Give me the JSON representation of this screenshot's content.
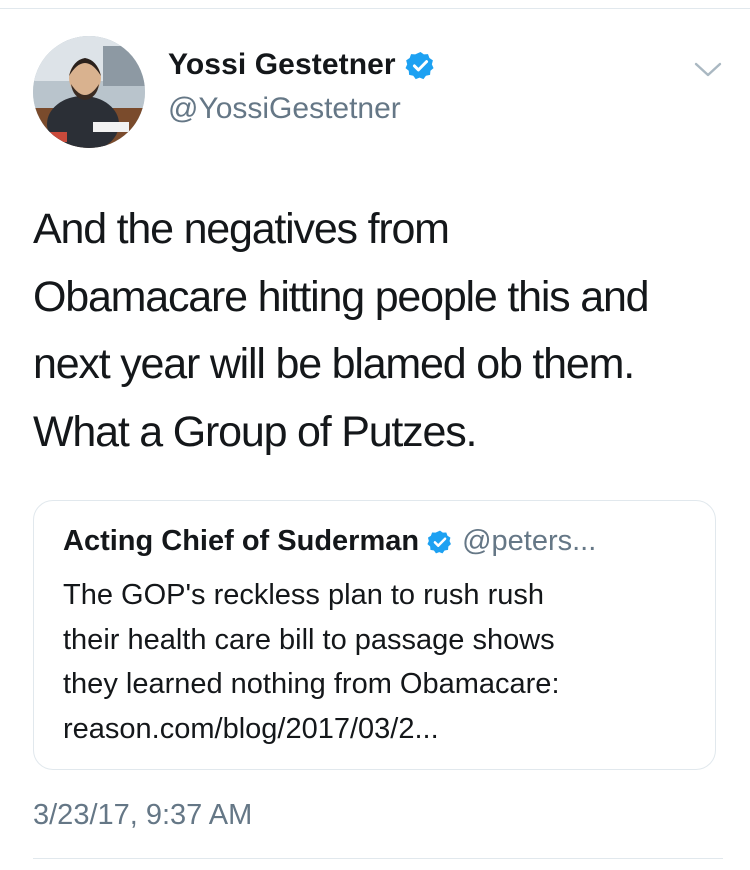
{
  "tweet": {
    "author": {
      "display_name": "Yossi Gestetner",
      "handle": "@YossiGestetner",
      "verified": true,
      "avatar_icon": "profile-photo"
    },
    "text_lines": [
      "And the negatives from",
      "Obamacare hitting people this and",
      "next year will be blamed ob them.",
      "What a Group of Putzes."
    ],
    "quoted_tweet": {
      "display_name": "Acting Chief of Suderman",
      "handle": "@peters...",
      "verified": true,
      "text_lines": [
        "The GOP's reckless plan to rush rush",
        "their health care bill to passage shows",
        "they learned nothing from Obamacare:",
        "reason.com/blog/2017/03/2..."
      ]
    },
    "timestamp": "3/23/17, 9:37 AM"
  },
  "colors": {
    "text_primary": "#14171a",
    "text_secondary": "#657786",
    "verified_blue": "#1da1f2",
    "border": "#e1e8ed",
    "caret": "#aab8c2"
  },
  "icons": {
    "verified": "verified-badge-icon",
    "more": "chevron-down-icon"
  }
}
